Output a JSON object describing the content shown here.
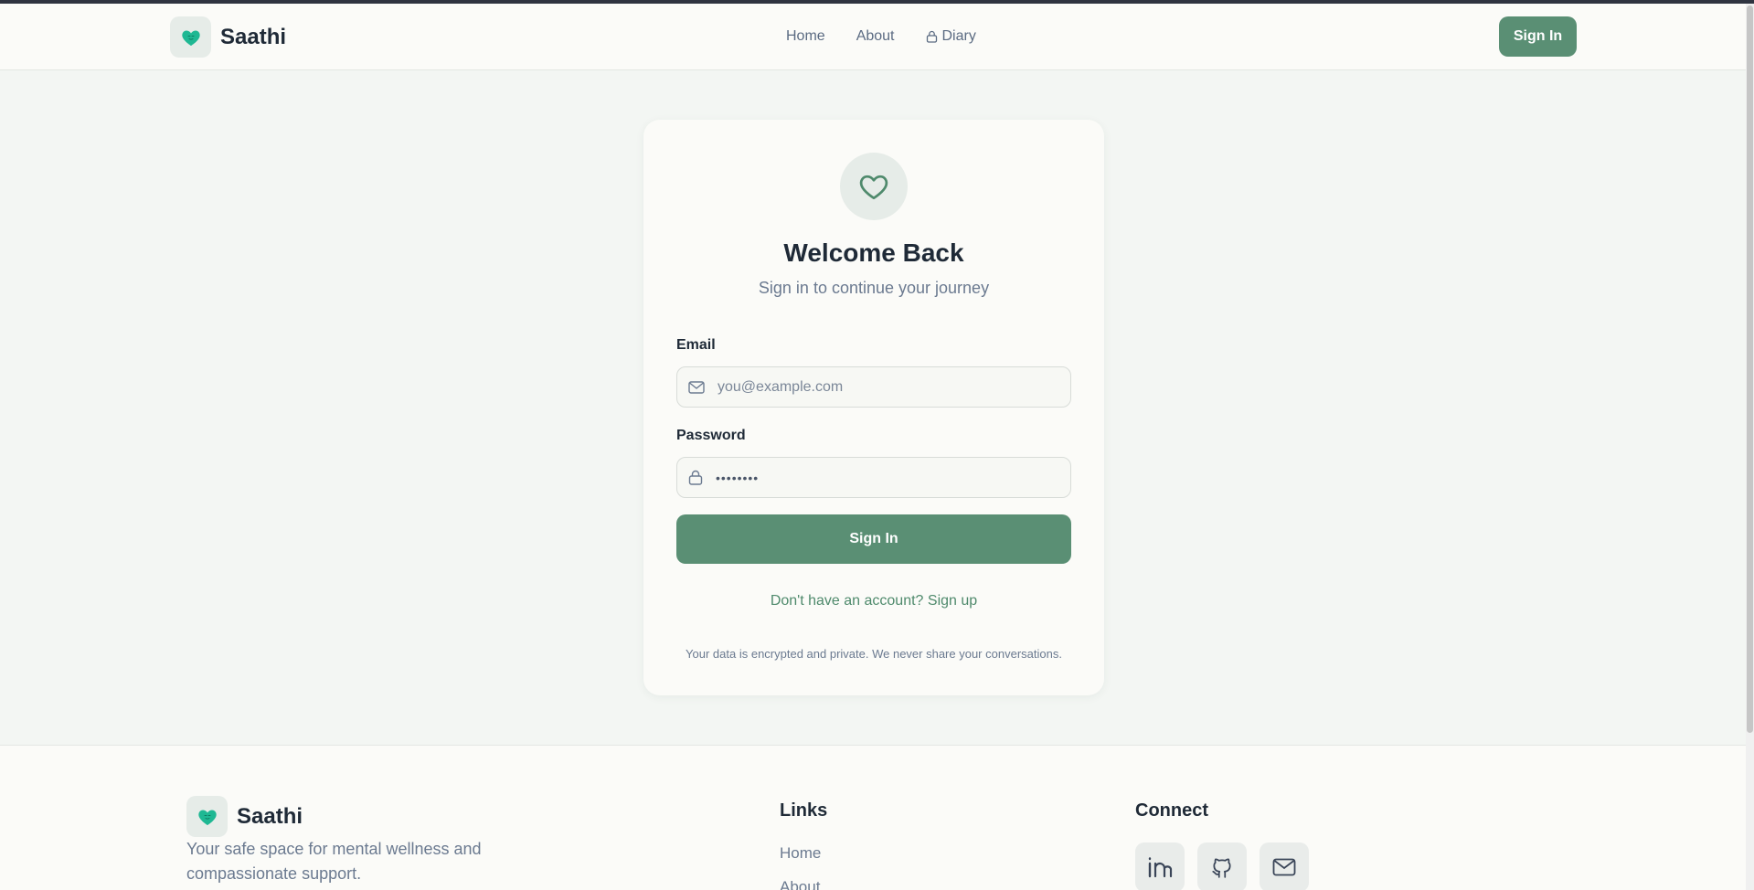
{
  "header": {
    "brand": "Saathi",
    "nav": [
      {
        "label": "Home",
        "icon": ""
      },
      {
        "label": "About",
        "icon": ""
      },
      {
        "label": "Diary",
        "icon": "lock-icon"
      }
    ],
    "signin_label": "Sign In"
  },
  "card": {
    "icon": "heart-icon",
    "title": "Welcome Back",
    "subtitle": "Sign in to continue your journey",
    "email_label": "Email",
    "email_placeholder": "you@example.com",
    "password_label": "Password",
    "password_value": "••••••••",
    "submit_label": "Sign In",
    "signup_text": "Don't have an account? Sign up",
    "privacy_text": "Your data is encrypted and private. We never share your conversations."
  },
  "footer": {
    "brand": "Saathi",
    "tagline": "Your safe space for mental wellness and compassionate support.",
    "links_heading": "Links",
    "links": [
      "Home",
      "About"
    ],
    "connect_heading": "Connect",
    "social": [
      "linkedin-icon",
      "github-icon",
      "mail-icon"
    ]
  },
  "colors": {
    "accent": "#5a8f74",
    "brand_heart": "#1fb893",
    "background": "#f3f6f3"
  }
}
